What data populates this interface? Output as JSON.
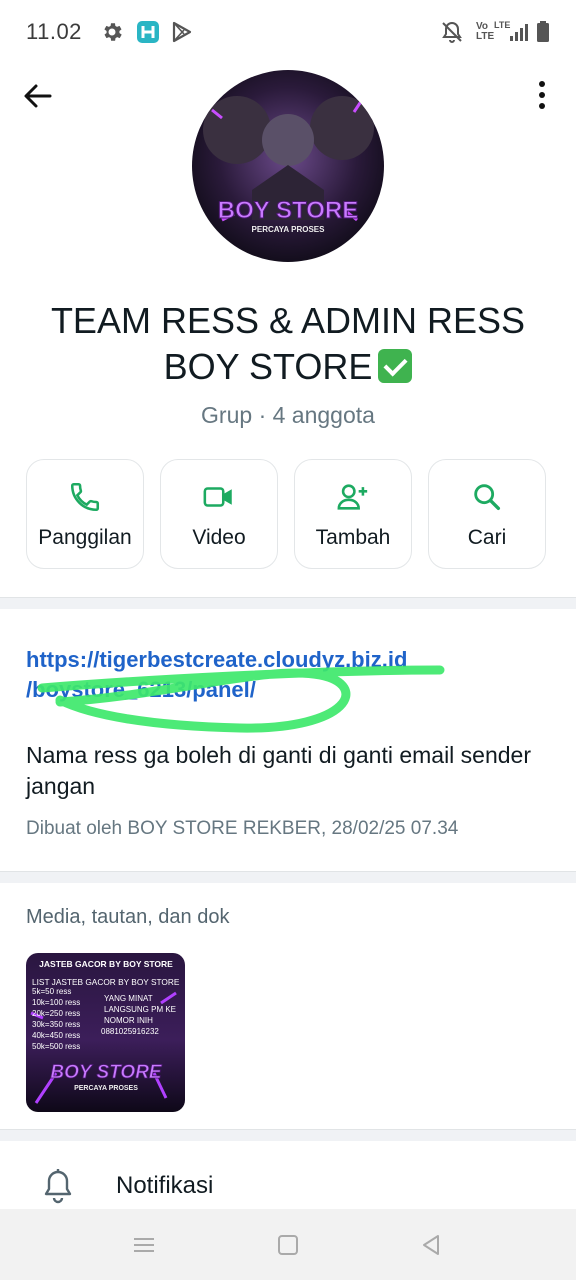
{
  "status_bar": {
    "time": "11.02",
    "left_icons": [
      "gear-icon",
      "h-app-icon",
      "play-store-icon"
    ],
    "right_icons": [
      "notifications-off-icon",
      "volte-icon",
      "lte-signal-icon",
      "battery-icon"
    ],
    "volte_text": "Vo LTE",
    "lte_text": "LTE"
  },
  "header": {
    "back_icon": "arrow-left-icon",
    "menu_icon": "more-vertical-icon"
  },
  "group": {
    "name": "TEAM RESS & ADMIN RESS BOY STORE",
    "verified_emoji": "check-mark-button-icon",
    "meta": "Grup · 4 anggota",
    "avatar_title": "BOY STORE",
    "avatar_subtitle": "PERCAYA PROSES"
  },
  "actions": [
    {
      "label": "Panggilan",
      "icon": "phone-icon"
    },
    {
      "label": "Video",
      "icon": "video-icon"
    },
    {
      "label": "Tambah",
      "icon": "add-person-icon"
    },
    {
      "label": "Cari",
      "icon": "search-icon"
    }
  ],
  "description": {
    "link_line1": "https://tigerbestcreate.cloudyz.biz.id",
    "link_line2": "/boystore_6213/panel/",
    "text": "Nama ress ga boleh di ganti di ganti email sender jangan",
    "created_by": "Dibuat oleh BOY STORE REKBER, 28/02/25 07.34"
  },
  "media": {
    "title": "Media, tautan, dan dok",
    "thumb": {
      "header": "JASTEB GACOR BY BOY STORE",
      "list_title": "LIST JASTEB GACOR BY BOY STORE",
      "items": [
        "5k=50 ress",
        "10k=100 ress",
        "20k=250 ress",
        "30k=350 ress",
        "40k=450 ress",
        "50k=500 ress"
      ],
      "right_lines": [
        "YANG MINAT",
        "LANGSUNG PM KE",
        "NOMOR INIH",
        "0881025916232"
      ],
      "brand": "BOY STORE",
      "tagline": "PERCAYA PROSES"
    }
  },
  "settings": {
    "notification_label": "Notifikasi",
    "notification_icon": "bell-icon"
  },
  "nav_bar": {
    "icons": [
      "menu-icon",
      "home-square-icon",
      "back-triangle-icon"
    ]
  },
  "colors": {
    "accent_green": "#1daa61",
    "link_blue": "#1f63c9",
    "scribble_green": "#3ee86b",
    "check_green": "#3fb34f"
  }
}
